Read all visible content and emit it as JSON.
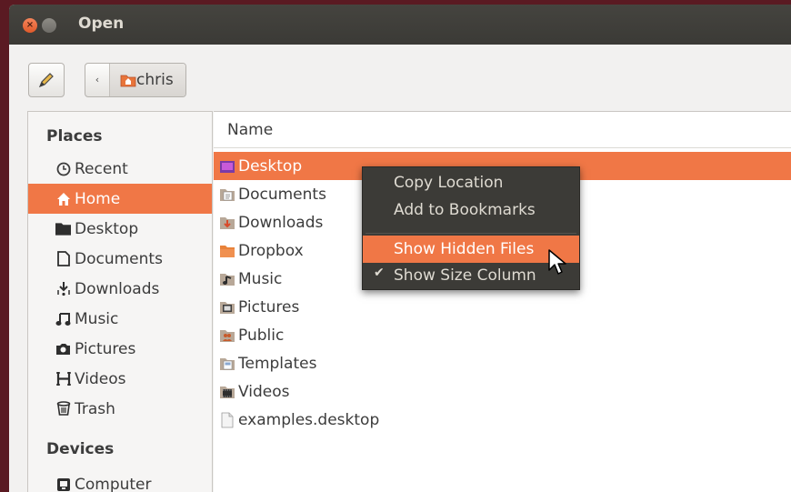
{
  "window": {
    "title": "Open"
  },
  "toolbar": {
    "path_back": "‹",
    "path_crumb": "chris"
  },
  "sidebar": {
    "places_heading": "Places",
    "places": [
      {
        "label": "Recent",
        "icon": "clock-icon"
      },
      {
        "label": "Home",
        "icon": "home-icon",
        "active": true
      },
      {
        "label": "Desktop",
        "icon": "folder-icon"
      },
      {
        "label": "Documents",
        "icon": "document-icon"
      },
      {
        "label": "Downloads",
        "icon": "download-icon"
      },
      {
        "label": "Music",
        "icon": "music-icon"
      },
      {
        "label": "Pictures",
        "icon": "camera-icon"
      },
      {
        "label": "Videos",
        "icon": "film-icon"
      },
      {
        "label": "Trash",
        "icon": "trash-icon"
      }
    ],
    "devices_heading": "Devices",
    "devices": [
      {
        "label": "Computer",
        "icon": "computer-icon"
      }
    ]
  },
  "filelist": {
    "column_name": "Name",
    "files": [
      {
        "name": "Desktop",
        "icon": "desktop-folder-icon",
        "selected": true
      },
      {
        "name": "Documents",
        "icon": "documents-folder-icon"
      },
      {
        "name": "Downloads",
        "icon": "downloads-folder-icon"
      },
      {
        "name": "Dropbox",
        "icon": "folder-icon"
      },
      {
        "name": "Music",
        "icon": "music-folder-icon"
      },
      {
        "name": "Pictures",
        "icon": "pictures-folder-icon"
      },
      {
        "name": "Public",
        "icon": "public-folder-icon"
      },
      {
        "name": "Templates",
        "icon": "templates-folder-icon"
      },
      {
        "name": "Videos",
        "icon": "videos-folder-icon"
      },
      {
        "name": "examples.desktop",
        "icon": "file-icon"
      }
    ]
  },
  "context_menu": {
    "items": [
      {
        "label": "Copy Location"
      },
      {
        "label": "Add to Bookmarks"
      },
      {
        "label": "Show Hidden Files",
        "highlighted": true
      },
      {
        "label": "Show Size Column",
        "checked": true,
        "check_glyph": "✔"
      }
    ]
  },
  "colors": {
    "accent": "#f07746",
    "titlebar": "#3c3b37",
    "menu_bg": "#3c3b37"
  }
}
